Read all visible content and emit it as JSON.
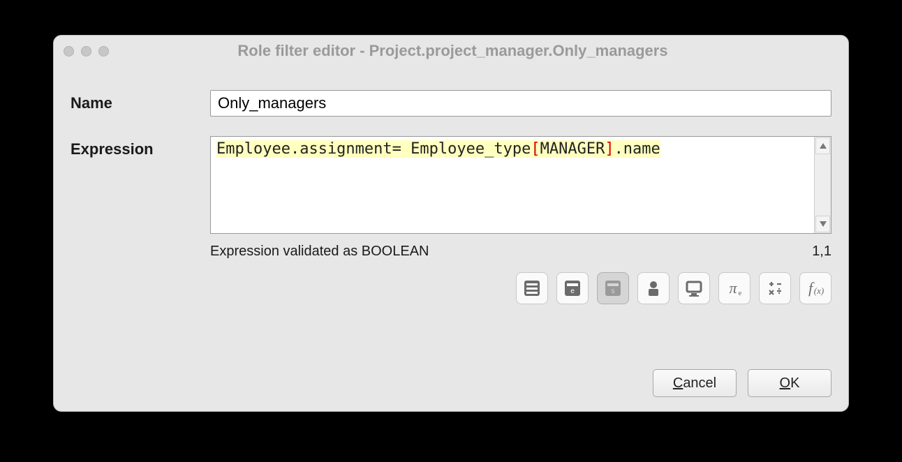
{
  "window": {
    "title": "Role filter editor - Project.project_manager.Only_managers"
  },
  "form": {
    "name_label": "Name",
    "name_value": "Only_managers",
    "expr_label": "Expression",
    "expr_parts": {
      "p1": "Employee.assignment= Employee_type",
      "lb": "[",
      "mid": "MANAGER",
      "rb": "]",
      "p2": ".name"
    }
  },
  "status": {
    "message": "Expression validated as BOOLEAN",
    "position": "1,1"
  },
  "toolbar": {
    "items": [
      {
        "name": "bars-icon",
        "active": false
      },
      {
        "name": "entity-icon",
        "active": false
      },
      {
        "name": "string-icon",
        "active": true
      },
      {
        "name": "person-icon",
        "active": false
      },
      {
        "name": "monitor-icon",
        "active": false
      },
      {
        "name": "pi-icon",
        "active": false
      },
      {
        "name": "operators-icon",
        "active": false
      },
      {
        "name": "function-icon",
        "active": false
      }
    ]
  },
  "buttons": {
    "cancel": "Cancel",
    "ok": "OK"
  }
}
